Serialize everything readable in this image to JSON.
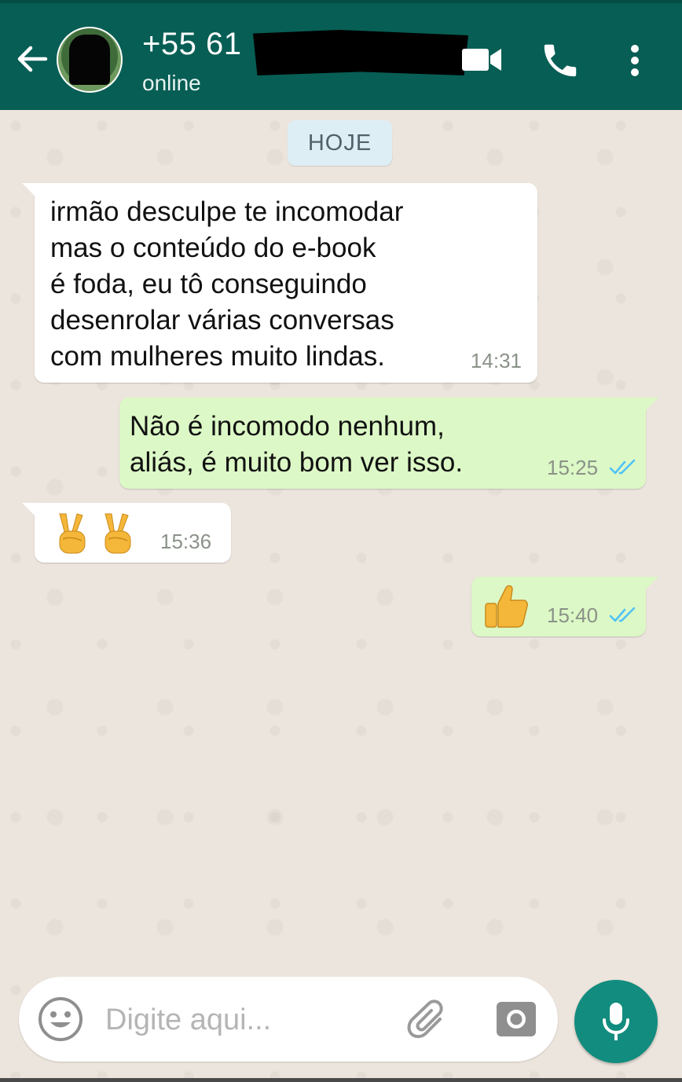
{
  "header": {
    "contact_name": "+55 61",
    "status": "online",
    "icons": {
      "back": "arrow-left-icon",
      "video": "video-camera-icon",
      "call": "phone-icon",
      "menu": "more-vertical-icon"
    }
  },
  "chat": {
    "date_label": "HOJE",
    "messages": [
      {
        "direction": "incoming",
        "text": "irmão desculpe te incomodar\nmas o conteúdo do e-book\né foda, eu tô conseguindo\ndesenrolar várias conversas\ncom mulheres muito lindas.",
        "time": "14:31"
      },
      {
        "direction": "outgoing",
        "text": "Não é incomodo nenhum,\naliás, é muito bom ver isso.",
        "time": "15:25",
        "read": true
      },
      {
        "direction": "incoming",
        "text": "✌️✌️",
        "time": "15:36"
      },
      {
        "direction": "outgoing",
        "text": "👍",
        "time": "15:40",
        "read": true
      }
    ]
  },
  "composer": {
    "placeholder": "Digite aqui...",
    "value": "",
    "icons": {
      "emoji": "smiley-icon",
      "attach": "paperclip-icon",
      "camera": "camera-icon",
      "mic": "microphone-icon"
    }
  },
  "colors": {
    "header": "#075E54",
    "outgoing_bubble": "#DCF8C6",
    "incoming_bubble": "#FFFFFF",
    "chat_background": "#ECE5DD",
    "read_ticks": "#4FC3F7",
    "mic_button": "#128C7E"
  }
}
